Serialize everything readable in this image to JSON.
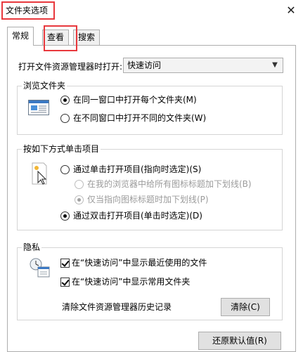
{
  "window": {
    "title": "文件夹选项",
    "close_glyph": "✕"
  },
  "tabs": [
    {
      "label": "常规",
      "active": true
    },
    {
      "label": "查看",
      "active": false
    },
    {
      "label": "搜索",
      "active": false
    }
  ],
  "open_explorer": {
    "label": "打开文件资源管理器时打开:",
    "selected": "快速访问"
  },
  "browse": {
    "title": "浏览文件夹",
    "options": [
      {
        "label": "在同一窗口中打开每个文件夹(M)",
        "checked": true
      },
      {
        "label": "在不同窗口中打开不同的文件夹(W)",
        "checked": false
      }
    ]
  },
  "click": {
    "title": "按如下方式单击项目",
    "options": [
      {
        "label": "通过单击打开项目(指向时选定)(S)",
        "checked": false,
        "disabled": false
      },
      {
        "label": "在我的浏览器中给所有图标标题加下划线(B)",
        "checked": false,
        "disabled": true
      },
      {
        "label": "仅当指向图标标题时加下划线(P)",
        "checked": true,
        "disabled": true
      },
      {
        "label": "通过双击打开项目(单击时选定)(D)",
        "checked": true,
        "disabled": false
      }
    ]
  },
  "privacy": {
    "title": "隐私",
    "checks": [
      {
        "label": "在“快速访问”中显示最近使用的文件",
        "checked": true
      },
      {
        "label": "在“快速访问”中显示常用文件夹",
        "checked": true
      }
    ],
    "clear_label": "清除文件资源管理器历史记录",
    "clear_button": "清除(C)"
  },
  "restore_button": "还原默认值(R)",
  "colors": {
    "highlight": "#e8383d",
    "border": "#adadad"
  }
}
